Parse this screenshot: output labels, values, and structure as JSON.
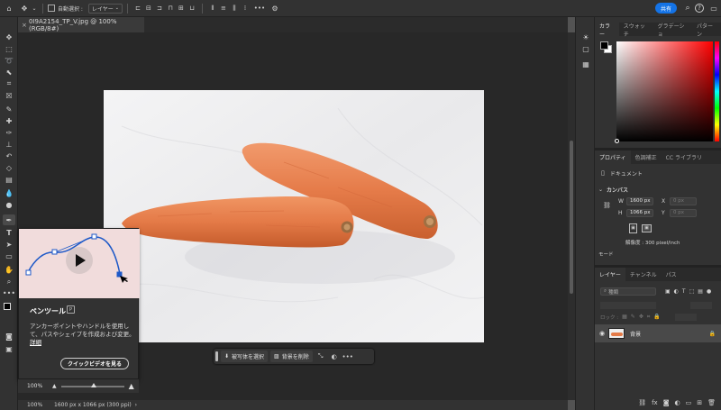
{
  "options_bar": {
    "auto_select_label": "自動選択 :",
    "auto_select_value": "レイヤー",
    "more_label": "•••",
    "share_label": "共有"
  },
  "document": {
    "tab_title": "0I9A2154_TP_V.jpg @ 100% (RGB/8#)"
  },
  "tooltip": {
    "title": "ペンツール",
    "shortcut": "P",
    "description": "アンカーポイントやハンドルを使用して、パスやシェイプを作成および変更。",
    "link": "詳細",
    "button": "クイックビデオを見る"
  },
  "zoom_widget": {
    "value": "100%"
  },
  "taskbar": {
    "select_subject": "被写体を選択",
    "remove_background": "背景を削除",
    "more": "•••"
  },
  "status_bar": {
    "zoom": "100%",
    "info": "1600 px x 1066 px (300 ppi)"
  },
  "color_panel": {
    "tabs": [
      "カラー",
      "スウォッチ",
      "グラデーショ",
      "パターン"
    ],
    "foreground": "#000000",
    "background": "#ffffff"
  },
  "properties_panel": {
    "tabs": [
      "プロパティ",
      "色調補正",
      "CC ライブラリ"
    ],
    "doc_label": "ドキュメント",
    "canvas_label": "カンバス",
    "w_label": "W",
    "w_value": "1600 px",
    "h_label": "H",
    "h_value": "1066 px",
    "x_label": "X",
    "x_placeholder": "0 px",
    "y_label": "Y",
    "y_placeholder": "0 px",
    "resolution": "解像度 : 300 pixel/inch",
    "mode_label": "モード"
  },
  "layers_panel": {
    "tabs": [
      "レイヤー",
      "チャンネル",
      "パス"
    ],
    "search_placeholder": "種類",
    "lock_label": "ロック :",
    "layer_name": "背景"
  }
}
